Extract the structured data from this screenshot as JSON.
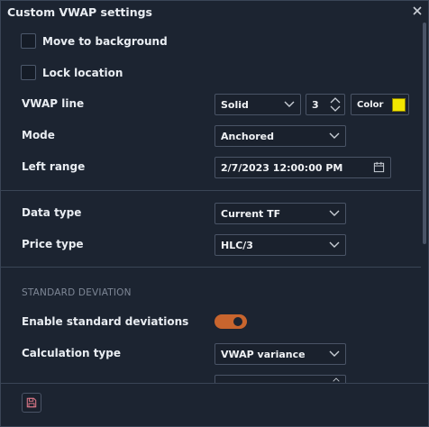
{
  "window": {
    "title": "Custom VWAP settings"
  },
  "options": {
    "move_to_background": "Move to background",
    "lock_location": "Lock location"
  },
  "vwap_line": {
    "label": "VWAP line",
    "style": "Solid",
    "width": "3",
    "color_label": "Color",
    "color": "#f2e600"
  },
  "mode": {
    "label": "Mode",
    "value": "Anchored"
  },
  "left_range": {
    "label": "Left range",
    "value": "2/7/2023 12:00:00 PM"
  },
  "data_type": {
    "label": "Data type",
    "value": "Current TF"
  },
  "price_type": {
    "label": "Price type",
    "value": "HLC/3"
  },
  "standard_deviation": {
    "section_title": "STANDARD DEVIATION",
    "enable_label": "Enable standard deviations",
    "enabled": true,
    "calc_label": "Calculation type",
    "calc_value": "VWAP variance"
  },
  "colors": {
    "accent": "#c8652e",
    "background": "#1c2431",
    "border": "#4a5466"
  },
  "icons": [
    "close-icon",
    "chevron-down-icon",
    "calendar-icon",
    "save-icon"
  ]
}
